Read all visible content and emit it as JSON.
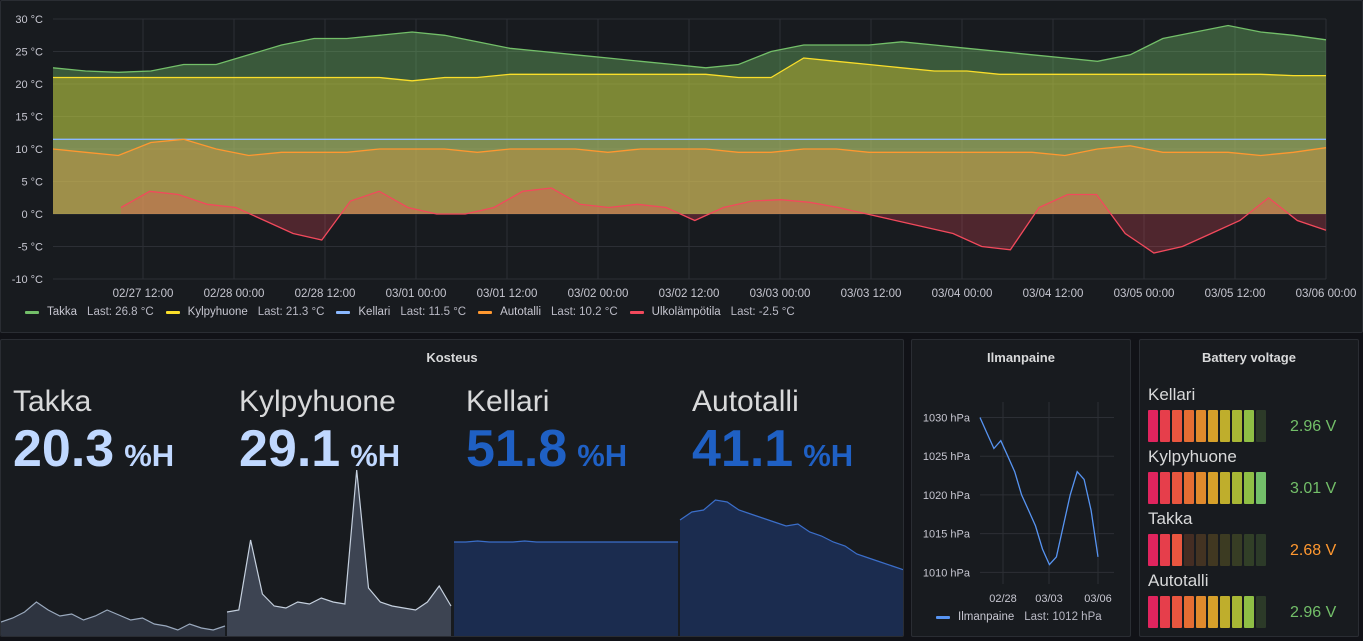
{
  "temperature_panel": {
    "chart_data": {
      "type": "area",
      "y_ticks": [
        "30 °C",
        "25 °C",
        "20 °C",
        "15 °C",
        "10 °C",
        "5 °C",
        "0 °C",
        "-5 °C",
        "-10 °C"
      ],
      "ylim": [
        -10,
        30
      ],
      "x_ticks": [
        "02/27 12:00",
        "02/28 00:00",
        "02/28 12:00",
        "03/01 00:00",
        "03/01 12:00",
        "03/02 00:00",
        "03/02 12:00",
        "03/03 00:00",
        "03/03 12:00",
        "03/04 00:00",
        "03/04 12:00",
        "03/05 00:00",
        "03/05 12:00",
        "03/06 00:00"
      ],
      "grid": true,
      "legend_placement": "bottom-left",
      "series": [
        {
          "name": "Takka",
          "color": "#73bf69",
          "values": [
            22.5,
            22,
            21.8,
            22,
            23,
            23,
            24.5,
            26,
            27,
            27,
            27.5,
            28,
            27.5,
            26.5,
            25.5,
            25,
            24.5,
            24,
            23.5,
            23,
            22.5,
            23,
            25,
            26,
            26,
            26,
            26.5,
            26,
            25.5,
            25,
            24.5,
            24,
            23.5,
            24.5,
            27,
            28,
            29,
            28,
            27.5,
            26.8
          ]
        },
        {
          "name": "Kylpyhuone",
          "color": "#fade2a",
          "values": [
            21,
            21,
            21,
            21,
            21,
            21,
            21,
            21,
            21,
            21,
            21,
            20.5,
            21,
            21,
            21.5,
            21.5,
            21.5,
            21.5,
            21.5,
            21.5,
            21.5,
            21,
            21,
            24,
            23.5,
            23,
            22.5,
            22,
            22,
            21.5,
            21.5,
            21.5,
            21.5,
            21.5,
            21.5,
            21.5,
            21.5,
            21.5,
            21.3,
            21.3
          ]
        },
        {
          "name": "Kellari",
          "color": "#8ab8ff",
          "values": [
            11.5,
            11.5,
            11.5,
            11.5,
            11.5,
            11.5,
            11.5,
            11.5,
            11.5,
            11.5,
            11.5,
            11.5,
            11.5,
            11.5,
            11.5,
            11.5,
            11.5,
            11.5,
            11.5,
            11.5,
            11.5,
            11.5,
            11.5,
            11.5,
            11.5,
            11.5,
            11.5,
            11.5,
            11.5,
            11.5,
            11.5,
            11.5,
            11.5,
            11.5,
            11.5,
            11.5,
            11.5,
            11.5,
            11.5,
            11.5
          ]
        },
        {
          "name": "Autotalli",
          "color": "#ff9830",
          "values": [
            10,
            9.5,
            9,
            11,
            11.5,
            10,
            9,
            9.5,
            9.5,
            9.5,
            10,
            10,
            10,
            9.5,
            10,
            10,
            10,
            9.5,
            10,
            10,
            10,
            9.5,
            9.5,
            10,
            10,
            9.5,
            9.5,
            9.5,
            9.5,
            9.5,
            9.5,
            9,
            10,
            10.5,
            9.5,
            9.5,
            9.5,
            9,
            9.5,
            10.2
          ]
        },
        {
          "name": "Ulkolämpötila",
          "color": "#f2495c",
          "values": [
            1,
            3.5,
            3,
            1.5,
            1,
            -1,
            -3,
            -4,
            2,
            3.5,
            1,
            0,
            0,
            1,
            3.5,
            4,
            1.5,
            1,
            1.5,
            1,
            -1,
            1,
            2,
            2.2,
            1.8,
            1,
            0,
            -1,
            -2,
            -3,
            -5,
            -5.5,
            1,
            3,
            3,
            -3,
            -6,
            -5,
            -3,
            -1,
            2.5,
            -1,
            -2.5
          ]
        }
      ]
    },
    "legend": [
      {
        "name": "Takka",
        "last": "Last: 26.8 °C",
        "color": "#73bf69"
      },
      {
        "name": "Kylpyhuone",
        "last": "Last: 21.3 °C",
        "color": "#fade2a"
      },
      {
        "name": "Kellari",
        "last": "Last: 11.5 °C",
        "color": "#8ab8ff"
      },
      {
        "name": "Autotalli",
        "last": "Last: 10.2 °C",
        "color": "#ff9830"
      },
      {
        "name": "Ulkolämpötila",
        "last": "Last: -2.5 °C",
        "color": "#f2495c"
      }
    ]
  },
  "humidity_panel": {
    "title": "Kosteus",
    "stats": [
      {
        "name": "Takka",
        "value": "20.3",
        "unit": "%H",
        "color": "#c0d8ff"
      },
      {
        "name": "Kylpyhuone",
        "value": "29.1",
        "unit": "%H",
        "color": "#c0d8ff"
      },
      {
        "name": "Kellari",
        "value": "51.8",
        "unit": "%H",
        "color": "#1f60c4"
      },
      {
        "name": "Autotalli",
        "value": "41.1",
        "unit": "%H",
        "color": "#1f60c4"
      }
    ]
  },
  "pressure_panel": {
    "title": "Ilmanpaine",
    "chart_data": {
      "type": "line",
      "y_ticks": [
        "1030 hPa",
        "1025 hPa",
        "1020 hPa",
        "1015 hPa",
        "1010 hPa"
      ],
      "ylim": [
        1008.5,
        1032
      ],
      "x_ticks": [
        "02/28",
        "03/03",
        "03/06"
      ],
      "series": [
        {
          "name": "Ilmanpaine",
          "color": "#5794f2",
          "values": [
            1030,
            1028,
            1026,
            1027,
            1025,
            1023,
            1020,
            1018,
            1016,
            1013,
            1011,
            1012,
            1016,
            1020,
            1023,
            1022,
            1018,
            1012
          ]
        }
      ]
    },
    "legend": {
      "name": "Ilmanpaine",
      "last": "Last: 1012 hPa",
      "color": "#5794f2"
    }
  },
  "battery_panel": {
    "title": "Battery voltage",
    "levels": [
      {
        "name": "Kellari",
        "value": "2.96 V",
        "fraction": 0.9,
        "value_color": "#73bf69"
      },
      {
        "name": "Kylpyhuone",
        "value": "3.01 V",
        "fraction": 1.0,
        "value_color": "#73bf69"
      },
      {
        "name": "Takka",
        "value": "2.68 V",
        "fraction": 0.3,
        "value_color": "#ff9830"
      },
      {
        "name": "Autotalli",
        "value": "2.96 V",
        "fraction": 0.9,
        "value_color": "#73bf69"
      }
    ]
  }
}
